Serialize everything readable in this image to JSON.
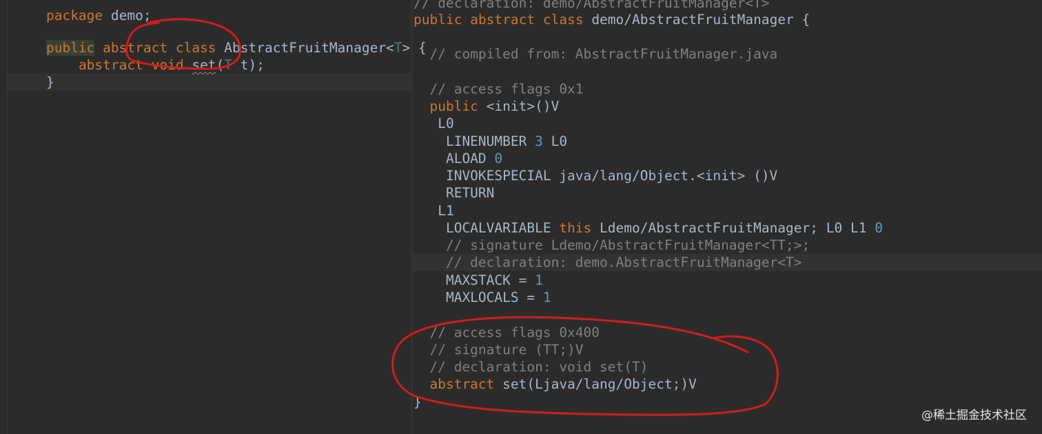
{
  "left_editor": {
    "l0": {
      "a": "package",
      "b": " demo;"
    },
    "l1": {
      "a": "public",
      "b": " ",
      "c": "abstract",
      "d": " ",
      "e": "class",
      "f": " AbstractFruitManager<",
      "g": "T",
      "h": "> {"
    },
    "l2": {
      "a": "    ",
      "b": "abstract",
      "c": " ",
      "d": "void",
      "e": " ",
      "f": "set",
      "g": "(",
      "h": "T",
      "i": " t);"
    },
    "l3": {
      "a": "}"
    }
  },
  "right_editor": {
    "r0": {
      "a": "// declaration: demo/AbstractFruitManager<T>"
    },
    "r1": {
      "a": "public",
      "b": " ",
      "c": "abstract",
      "d": " ",
      "e": "class",
      "f": " demo/AbstractFruitManager {"
    },
    "r2": {
      "a": "  // compiled from: AbstractFruitManager.java"
    },
    "r3": {
      "a": "  // access flags 0x1"
    },
    "r4": {
      "a": "  ",
      "b": "public",
      "c": " <init>()V"
    },
    "r5": {
      "a": "   L0"
    },
    "r6": {
      "a": "    LINENUMBER ",
      "b": "3",
      "c": " L0"
    },
    "r7": {
      "a": "    ALOAD ",
      "b": "0"
    },
    "r8": {
      "a": "    INVOKESPECIAL java/lang/Object.<init> ()V"
    },
    "r9": {
      "a": "    RETURN"
    },
    "r10": {
      "a": "   L1"
    },
    "r11": {
      "a": "    LOCALVARIABLE ",
      "b": "this",
      "c": " Ldemo/AbstractFruitManager; L0 L1 ",
      "d": "0"
    },
    "r12": {
      "a": "    // signature Ldemo/AbstractFruitManager<TT;>;"
    },
    "r13": {
      "a": "    // declaration: demo.AbstractFruitManager<T>"
    },
    "r14": {
      "a": "    MAXSTACK = ",
      "b": "1"
    },
    "r15": {
      "a": "    MAXLOCALS = ",
      "b": "1"
    },
    "r16": {
      "a": "  // access flags 0x400"
    },
    "r17": {
      "a": "  // signature (TT;)V"
    },
    "r18": {
      "a": "  // declaration: void set(T)"
    },
    "r19": {
      "a": "  ",
      "b": "abstract",
      "c": " set(Ljava/lang/Object;)V"
    },
    "r20": {
      "a": "}"
    }
  },
  "watermark": "@稀土掘金技术社区",
  "colors": {
    "keyword": "#cc7832",
    "comment": "#808080",
    "type_param": "#507874",
    "number": "#6897bb",
    "text": "#a9b7c6",
    "annotation": "#d41c1c"
  }
}
